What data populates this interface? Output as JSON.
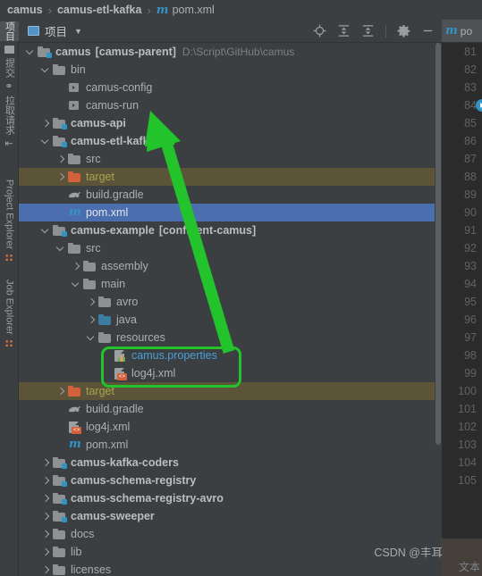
{
  "breadcrumb": {
    "items": [
      "camus",
      "camus-etl-kafka"
    ],
    "file": "pom.xml",
    "separator": "›"
  },
  "left_toolbar": {
    "items": [
      {
        "label": "项目",
        "icon": "project-icon",
        "active": true
      },
      {
        "label": "",
        "icon": "folder-icon",
        "active": false
      },
      {
        "label": "提交",
        "icon": "commit-icon",
        "active": false
      },
      {
        "label": "拉取请求",
        "icon": "pull-request-icon",
        "active": false
      },
      {
        "label": "Project Explorer",
        "icon": "talend-icon",
        "active": false
      },
      {
        "label": "Job Explorer",
        "icon": "talend-icon",
        "active": false
      }
    ]
  },
  "panel": {
    "title": "项目",
    "caret": "▼",
    "tools": [
      {
        "name": "locate-icon",
        "tip": "Select Opened File"
      },
      {
        "name": "expand-all-icon",
        "tip": "Expand All"
      },
      {
        "name": "collapse-all-icon",
        "tip": "Collapse All"
      },
      {
        "name": "gear-icon",
        "tip": "Settings"
      },
      {
        "name": "minimize-icon",
        "tip": "Hide"
      }
    ]
  },
  "tree": [
    {
      "label": "camus",
      "bracket": "[camus-parent]",
      "sub": "D:\\Script\\GitHub\\camus",
      "indent": 0,
      "arrow": "down",
      "icon": "module-folder",
      "style": "bold"
    },
    {
      "label": "bin",
      "indent": 1,
      "arrow": "down",
      "icon": "folder",
      "style": "normal"
    },
    {
      "label": "camus-config",
      "indent": 2,
      "arrow": "none",
      "icon": "script",
      "style": "normal"
    },
    {
      "label": "camus-run",
      "indent": 2,
      "arrow": "none",
      "icon": "script",
      "style": "normal"
    },
    {
      "label": "camus-api",
      "indent": 1,
      "arrow": "right",
      "icon": "module-folder",
      "style": "bold"
    },
    {
      "label": "camus-etl-kafka",
      "indent": 1,
      "arrow": "down",
      "icon": "module-folder",
      "style": "bold"
    },
    {
      "label": "src",
      "indent": 2,
      "arrow": "right",
      "icon": "folder",
      "style": "normal"
    },
    {
      "label": "target",
      "indent": 2,
      "arrow": "right",
      "icon": "folder-orange",
      "style": "excluded"
    },
    {
      "label": "build.gradle",
      "indent": 2,
      "arrow": "none",
      "icon": "gradle",
      "style": "normal"
    },
    {
      "label": "pom.xml",
      "indent": 2,
      "arrow": "none",
      "icon": "maven",
      "style": "selected"
    },
    {
      "label": "camus-example",
      "bracket": "[confluent-camus]",
      "indent": 1,
      "arrow": "down",
      "icon": "module-folder",
      "style": "bold"
    },
    {
      "label": "src",
      "indent": 2,
      "arrow": "down",
      "icon": "folder",
      "style": "normal"
    },
    {
      "label": "assembly",
      "indent": 3,
      "arrow": "right",
      "icon": "folder",
      "style": "normal"
    },
    {
      "label": "main",
      "indent": 3,
      "arrow": "down",
      "icon": "folder",
      "style": "normal"
    },
    {
      "label": "avro",
      "indent": 4,
      "arrow": "right",
      "icon": "folder",
      "style": "normal"
    },
    {
      "label": "java",
      "indent": 4,
      "arrow": "right",
      "icon": "folder-blue",
      "style": "normal"
    },
    {
      "label": "resources",
      "indent": 4,
      "arrow": "down",
      "icon": "folder",
      "style": "normal"
    },
    {
      "label": "camus.properties",
      "indent": 5,
      "arrow": "none",
      "icon": "properties",
      "style": "link"
    },
    {
      "label": "log4j.xml",
      "indent": 5,
      "arrow": "none",
      "icon": "xml",
      "style": "normal"
    },
    {
      "label": "target",
      "indent": 2,
      "arrow": "right",
      "icon": "folder-orange",
      "style": "excluded"
    },
    {
      "label": "build.gradle",
      "indent": 2,
      "arrow": "none",
      "icon": "gradle",
      "style": "normal"
    },
    {
      "label": "log4j.xml",
      "indent": 2,
      "arrow": "none",
      "icon": "xml",
      "style": "normal"
    },
    {
      "label": "pom.xml",
      "indent": 2,
      "arrow": "none",
      "icon": "maven",
      "style": "normal"
    },
    {
      "label": "camus-kafka-coders",
      "indent": 1,
      "arrow": "right",
      "icon": "module-folder",
      "style": "bold"
    },
    {
      "label": "camus-schema-registry",
      "indent": 1,
      "arrow": "right",
      "icon": "module-folder",
      "style": "bold"
    },
    {
      "label": "camus-schema-registry-avro",
      "indent": 1,
      "arrow": "right",
      "icon": "module-folder",
      "style": "bold"
    },
    {
      "label": "camus-sweeper",
      "indent": 1,
      "arrow": "right",
      "icon": "module-folder",
      "style": "bold"
    },
    {
      "label": "docs",
      "indent": 1,
      "arrow": "right",
      "icon": "folder",
      "style": "normal"
    },
    {
      "label": "lib",
      "indent": 1,
      "arrow": "right",
      "icon": "folder",
      "style": "normal"
    },
    {
      "label": "licenses",
      "indent": 1,
      "arrow": "right",
      "icon": "folder",
      "style": "normal"
    }
  ],
  "editor": {
    "tab_label": "po",
    "tab_icon": "maven-m-icon",
    "line_numbers": [
      81,
      82,
      83,
      84,
      85,
      86,
      87,
      88,
      89,
      90,
      91,
      92,
      93,
      94,
      95,
      96,
      97,
      98,
      99,
      100,
      101,
      102,
      103,
      104,
      105
    ],
    "run_marker_line": 84
  },
  "annotations": {
    "arrow_color": "#22c32b",
    "box_color": "#22c32b",
    "watermark": "CSDN @丰耳",
    "watermark_corner": "文本"
  },
  "colors": {
    "background": "#3c3f41",
    "selection": "#4b6eaf",
    "excluded_row": "#5b5438",
    "excluded_text": "#a7a44f",
    "link": "#4b9fd5",
    "editor_bg": "#2b2b2b"
  }
}
